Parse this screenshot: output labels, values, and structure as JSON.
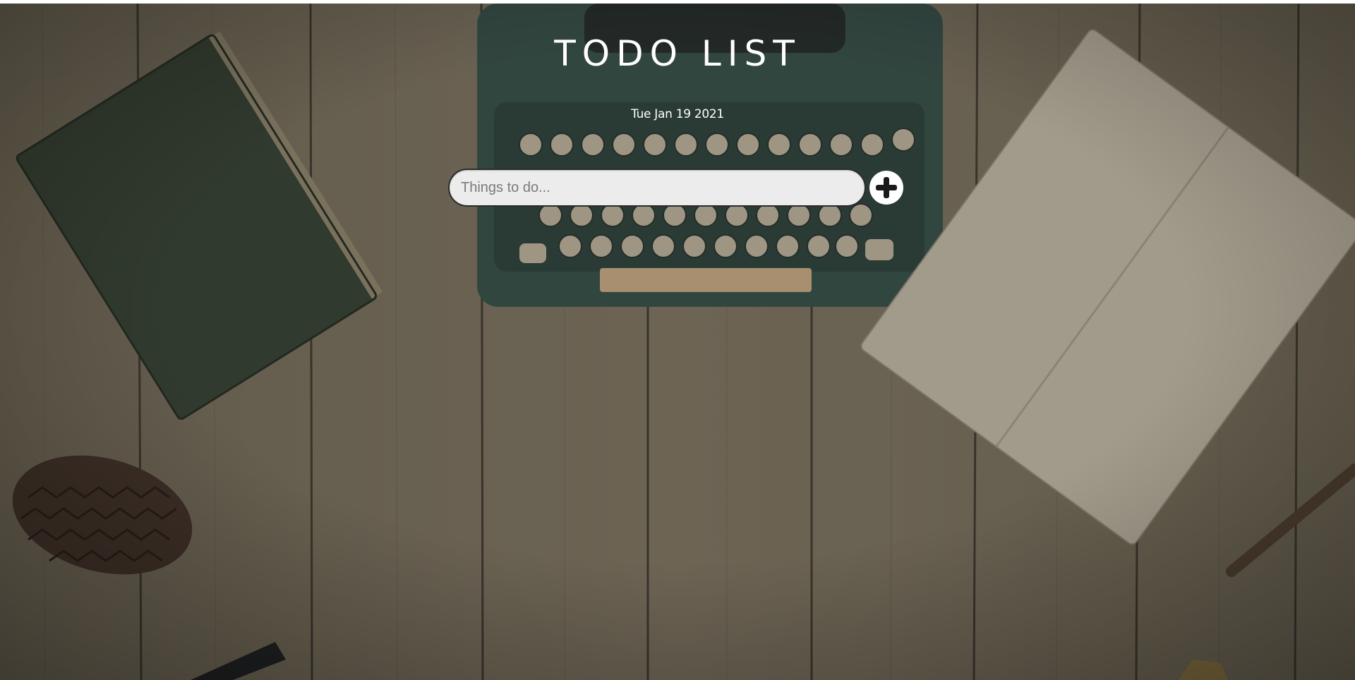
{
  "app": {
    "title": "TODO LIST",
    "date": "Tue Jan 19 2021"
  },
  "todo_form": {
    "input_placeholder": "Things to do...",
    "input_value": "",
    "add_icon": "plus-circle-icon"
  },
  "colors": {
    "title_text": "#ffffff",
    "input_background": "#ececec",
    "add_button_background": "#ffffff",
    "add_icon_color": "#1a1a1a",
    "background_overlay": "#3f3b33"
  }
}
